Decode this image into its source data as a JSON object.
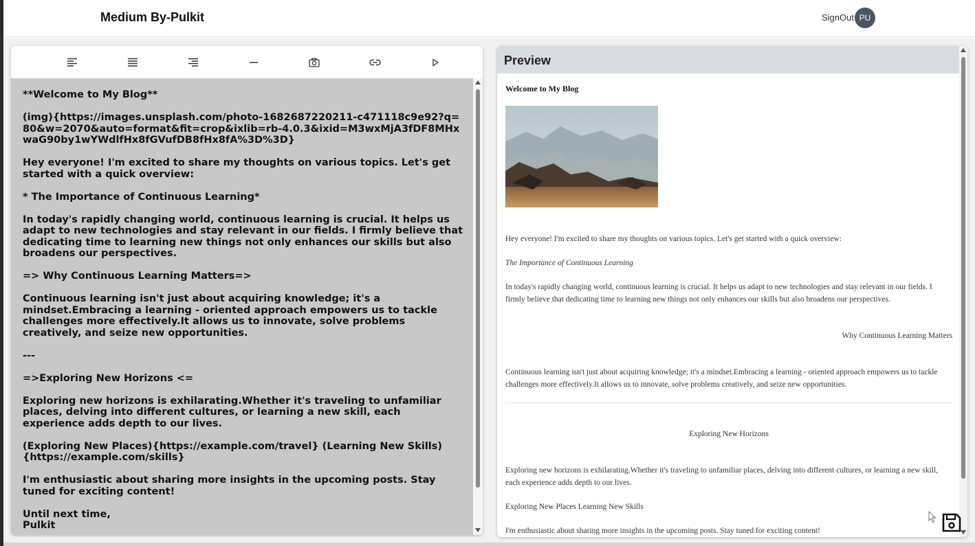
{
  "header": {
    "brand": "Medium By-Pulkit",
    "signout_label": "SignOut",
    "avatar_initials": "PU"
  },
  "toolbar": {
    "tools": [
      {
        "icon": "align-left-icon"
      },
      {
        "icon": "align-justify-icon"
      },
      {
        "icon": "align-right-icon"
      },
      {
        "icon": "horizontal-rule-icon"
      },
      {
        "icon": "camera-icon"
      },
      {
        "icon": "link-icon"
      },
      {
        "icon": "play-icon"
      }
    ]
  },
  "editor": {
    "lines": [
      "**Welcome to My Blog**",
      "(img){https://images.unsplash.com/photo-1682687220211-c471118c9e92?q=80&w=2070&auto=format&fit=crop&ixlib=rb-4.0.3&ixid=M3wxMjA3fDF8MHxwaG90by1wYWdlfHx8fGVufDB8fHx8fA%3D%3D}",
      "Hey everyone! I'm excited to share my thoughts on various topics. Let's get started with a quick overview:",
      "* The Importance of Continuous Learning*",
      "In today's rapidly changing world, continuous learning is crucial. It helps us adapt to new technologies and stay relevant in our fields. I firmly believe that dedicating time to learning new things not only enhances our skills but also broadens our perspectives.",
      "=> Why Continuous Learning Matters=>",
      "Continuous learning isn't just about acquiring knowledge; it's a mindset.Embracing a learning - oriented approach empowers us to tackle challenges more effectively.It allows us to innovate, solve problems creatively, and seize new opportunities.",
      "---",
      "=>Exploring New Horizons <=",
      "Exploring new horizons is exhilarating.Whether it's traveling to unfamiliar places, delving into different cultures, or learning a new skill, each experience adds depth to our lives.",
      "(Exploring New Places){https://example.com/travel} (Learning New Skills){https://example.com/skills}",
      "I'm enthusiastic about sharing more insights in the upcoming posts. Stay tuned for exciting content!",
      "Until next time,",
      "Pulkit"
    ]
  },
  "preview": {
    "heading": "Preview",
    "title": "Welcome to My Blog",
    "intro": "Hey everyone! I'm excited to share my thoughts on various topics. Let's get started with a quick overview:",
    "subheading": "The Importance of Continuous Learning",
    "para1": "In today's rapidly changing world, continuous learning is crucial. It helps us adapt to new technologies and stay relevant in our fields. I firmly believe that dedicating time to learning new things not only enhances our skills but also broadens our perspectives.",
    "right_heading": "Why Continuous Learning Matters",
    "para2": "Continuous learning isn't just about acquiring knowledge; it's a mindset.Embracing a learning - oriented approach empowers us to tackle challenges more effectively.It allows us to innovate, solve problems creatively, and seize new opportunities.",
    "center_heading": "Exploring New Horizons",
    "para3": "Exploring new horizons is exhilarating.Whether it's traveling to unfamiliar places, delving into different cultures, or learning a new skill, each experience adds depth to our lives.",
    "links": "Exploring New Places Learning New Skills",
    "para4": "I'm enthusiastic about sharing more insights in the upcoming posts. Stay tuned for exciting content!"
  },
  "colors": {
    "editor_bg": "#c8c8c8",
    "preview_header_bg": "#d9dde3",
    "avatar_bg": "#4b5563"
  }
}
